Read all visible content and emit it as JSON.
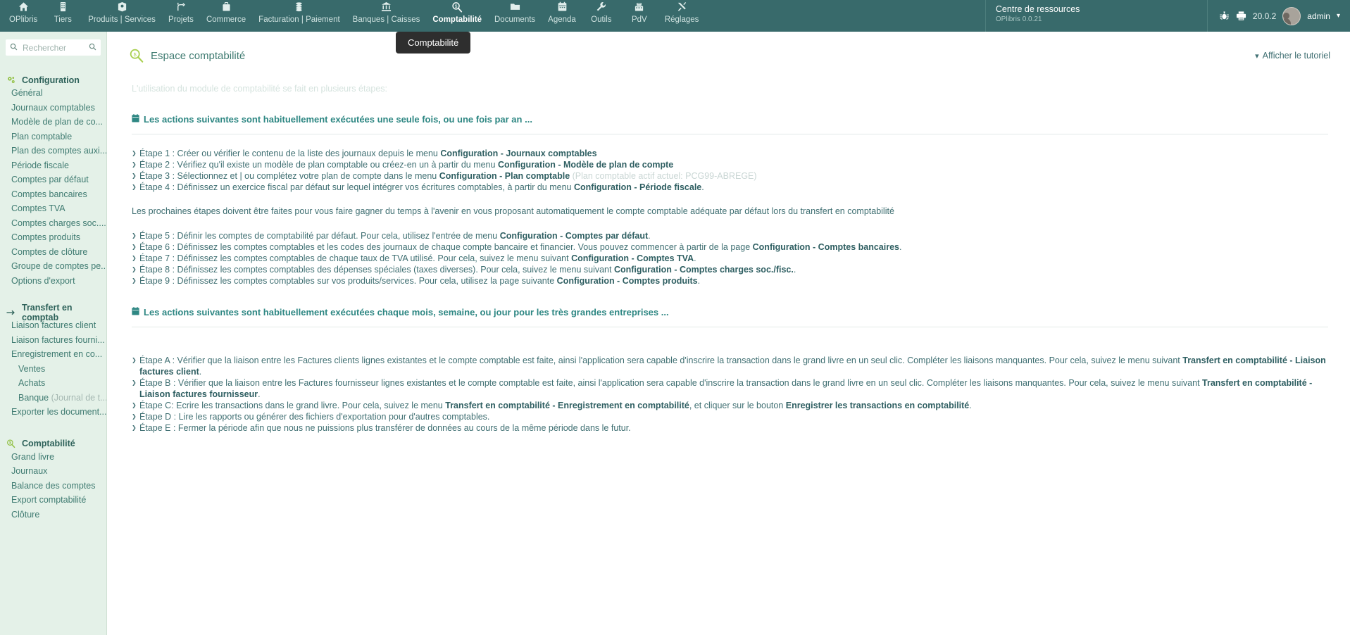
{
  "topbar": {
    "menu": [
      {
        "label": "OPlibris",
        "icon": "home-icon"
      },
      {
        "label": "Tiers",
        "icon": "building-icon"
      },
      {
        "label": "Produits | Services",
        "icon": "box-icon"
      },
      {
        "label": "Projets",
        "icon": "project-icon"
      },
      {
        "label": "Commerce",
        "icon": "briefcase-icon"
      },
      {
        "label": "Facturation | Paiement",
        "icon": "coins-icon"
      },
      {
        "label": "Banques | Caisses",
        "icon": "bank-icon"
      },
      {
        "label": "Comptabilité",
        "icon": "accounting-magnifier-icon"
      },
      {
        "label": "Documents",
        "icon": "folder-icon"
      },
      {
        "label": "Agenda",
        "icon": "calendar-icon"
      },
      {
        "label": "Outils",
        "icon": "wrench-icon"
      },
      {
        "label": "PdV",
        "icon": "cash-register-icon"
      },
      {
        "label": "Réglages",
        "icon": "tools-icon"
      }
    ],
    "active_menu": "Comptabilité",
    "resource_center": {
      "title": "Centre de ressources",
      "subtitle": "OPlibris 0.0.21"
    },
    "version": "20.0.2",
    "user": "admin",
    "colors": {
      "topbar_bg": "#386a6b",
      "sidebar_bg": "#e4f1e8",
      "link": "#3f7b71",
      "accent_green": "#8fbf3f",
      "section": "#2e8783"
    }
  },
  "sidebar": {
    "search": {
      "placeholder": "Rechercher",
      "value": ""
    },
    "groups": [
      {
        "title": "Configuration",
        "icon": "gears-icon",
        "items": [
          {
            "label": "Général",
            "indent": false
          },
          {
            "label": "Journaux comptables",
            "indent": false
          },
          {
            "label": "Modèle de plan de co...",
            "indent": false
          },
          {
            "label": "Plan comptable",
            "indent": false
          },
          {
            "label": "Plan des comptes auxi...",
            "indent": false
          },
          {
            "label": "Période fiscale",
            "indent": false
          },
          {
            "label": "Comptes par défaut",
            "indent": false
          },
          {
            "label": "Comptes bancaires",
            "indent": false
          },
          {
            "label": "Comptes TVA",
            "indent": false
          },
          {
            "label": "Comptes charges soc....",
            "indent": false
          },
          {
            "label": "Comptes produits",
            "indent": false
          },
          {
            "label": "Comptes de clôture",
            "indent": false
          },
          {
            "label": "Groupe de comptes pe...",
            "indent": false
          },
          {
            "label": "Options d'export",
            "indent": false
          }
        ]
      },
      {
        "title": "Transfert en comptab",
        "icon": "arrow-right-icon",
        "items": [
          {
            "label": "Liaison factures client",
            "indent": false
          },
          {
            "label": "Liaison factures fourni...",
            "indent": false
          },
          {
            "label": "Enregistrement en co...",
            "indent": false
          },
          {
            "label": "Ventes",
            "indent": true
          },
          {
            "label": "Achats",
            "indent": true
          },
          {
            "label": "Banque",
            "indent": true,
            "muted": " (Journal de t..."
          },
          {
            "label": "Exporter les document...",
            "indent": false
          }
        ]
      },
      {
        "title": "Comptabilité",
        "icon": "accounting-magnifier-icon",
        "items": [
          {
            "label": "Grand livre",
            "indent": false
          },
          {
            "label": "Journaux",
            "indent": false
          },
          {
            "label": "Balance des comptes",
            "indent": false
          },
          {
            "label": "Export comptabilité",
            "indent": false
          },
          {
            "label": "Clôture",
            "indent": false
          }
        ]
      }
    ]
  },
  "main": {
    "page_title": "Espace comptabilité",
    "tutorial_toggle": "Afficher le tutoriel",
    "tooltip": "Comptabilité",
    "intro": "L'utilisation du module de comptabilité se fait en plusieurs étapes:",
    "section1": {
      "heading": "Les actions suivantes sont habituellement exécutées une seule fois, ou une fois par an ...",
      "steps_a": [
        {
          "text_before": "Étape 1 : Créer ou vérifier le contenu de la liste des journaux depuis le menu ",
          "bold": "Configuration - Journaux comptables",
          "text_after": ""
        },
        {
          "text_before": "Étape 2 : Vérifiez qu'il existe un modèle de plan comptable ou créez-en un à partir du menu ",
          "bold": "Configuration - Modèle de plan de compte",
          "text_after": ""
        },
        {
          "text_before": "Étape 3 : Sélectionnez et | ou complétez votre plan de compte dans le menu ",
          "bold": "Configuration - Plan comptable",
          "text_after": "",
          "dim": " (Plan comptable actif actuel: PCG99-ABREGE)"
        },
        {
          "text_before": "Étape 4 : Définissez un exercice fiscal par défaut sur lequel intégrer vos écritures comptables, à partir du menu ",
          "bold": "Configuration - Période fiscale",
          "text_after": "."
        }
      ],
      "paragraph": "Les prochaines étapes doivent être faites pour vous faire gagner du temps à l'avenir en vous proposant automatiquement le compte comptable adéquate par défaut lors du transfert en comptabilité",
      "steps_b": [
        {
          "text_before": "Étape 5 : Définir les comptes de comptabilité par défaut. Pour cela, utilisez l'entrée de menu ",
          "bold": "Configuration - Comptes par défaut",
          "text_after": "."
        },
        {
          "text_before": "Étape 6 : Définissez les comptes comptables et les codes des journaux de chaque compte bancaire et financier. Vous pouvez commencer à partir de la page ",
          "bold": "Configuration - Comptes bancaires",
          "text_after": "."
        },
        {
          "text_before": "Étape 7 : Définissez les comptes comptables de chaque taux de TVA utilisé. Pour cela, suivez le menu suivant ",
          "bold": "Configuration - Comptes TVA",
          "text_after": "."
        },
        {
          "text_before": "Étape 8 : Définissez les comptes comptables des dépenses spéciales (taxes diverses). Pour cela, suivez le menu suivant ",
          "bold": "Configuration - Comptes charges soc./fisc.",
          "text_after": "."
        },
        {
          "text_before": "Étape 9 : Définissez les comptes comptables sur vos produits/services. Pour cela, utilisez la page suivante ",
          "bold": "Configuration - Comptes produits",
          "text_after": "."
        }
      ]
    },
    "section2": {
      "heading": "Les actions suivantes sont habituellement exécutées chaque mois, semaine, ou jour pour les très grandes entreprises ...",
      "steps": [
        {
          "text_before": "Étape A : Vérifier que la liaison entre les Factures clients lignes existantes et le compte comptable est faite, ainsi l'application sera capable d'inscrire la transaction dans le grand livre en un seul clic. Compléter les liaisons manquantes. Pour cela, suivez le menu suivant ",
          "bold": "Transfert en comptabilité - Liaison factures client",
          "text_after": "."
        },
        {
          "text_before": "Étape B : Vérifier que la liaison entre les Factures fournisseur lignes existantes et le compte comptable est faite, ainsi l'application sera capable d'inscrire la transaction dans le grand livre en un seul clic. Compléter les liaisons manquantes. Pour cela, suivez le menu suivant ",
          "bold": "Transfert en comptabilité - Liaison factures fournisseur",
          "text_after": "."
        },
        {
          "text_before": "Étape C: Ecrire les transactions dans le grand livre. Pour cela, suivez le menu ",
          "bold": "Transfert en comptabilité - Enregistrement en comptabilité",
          "text_mid": ", et cliquer sur le bouton ",
          "bold2": "Enregistrer les transactions en comptabilité",
          "text_after": "."
        },
        {
          "text_before": "Étape D : Lire les rapports ou générer des fichiers d'exportation pour d'autres comptables.",
          "bold": "",
          "text_after": ""
        },
        {
          "text_before": "Étape E : Fermer la période afin que nous ne puissions plus transférer de données au cours de la même période dans le futur.",
          "bold": "",
          "text_after": ""
        }
      ]
    }
  }
}
